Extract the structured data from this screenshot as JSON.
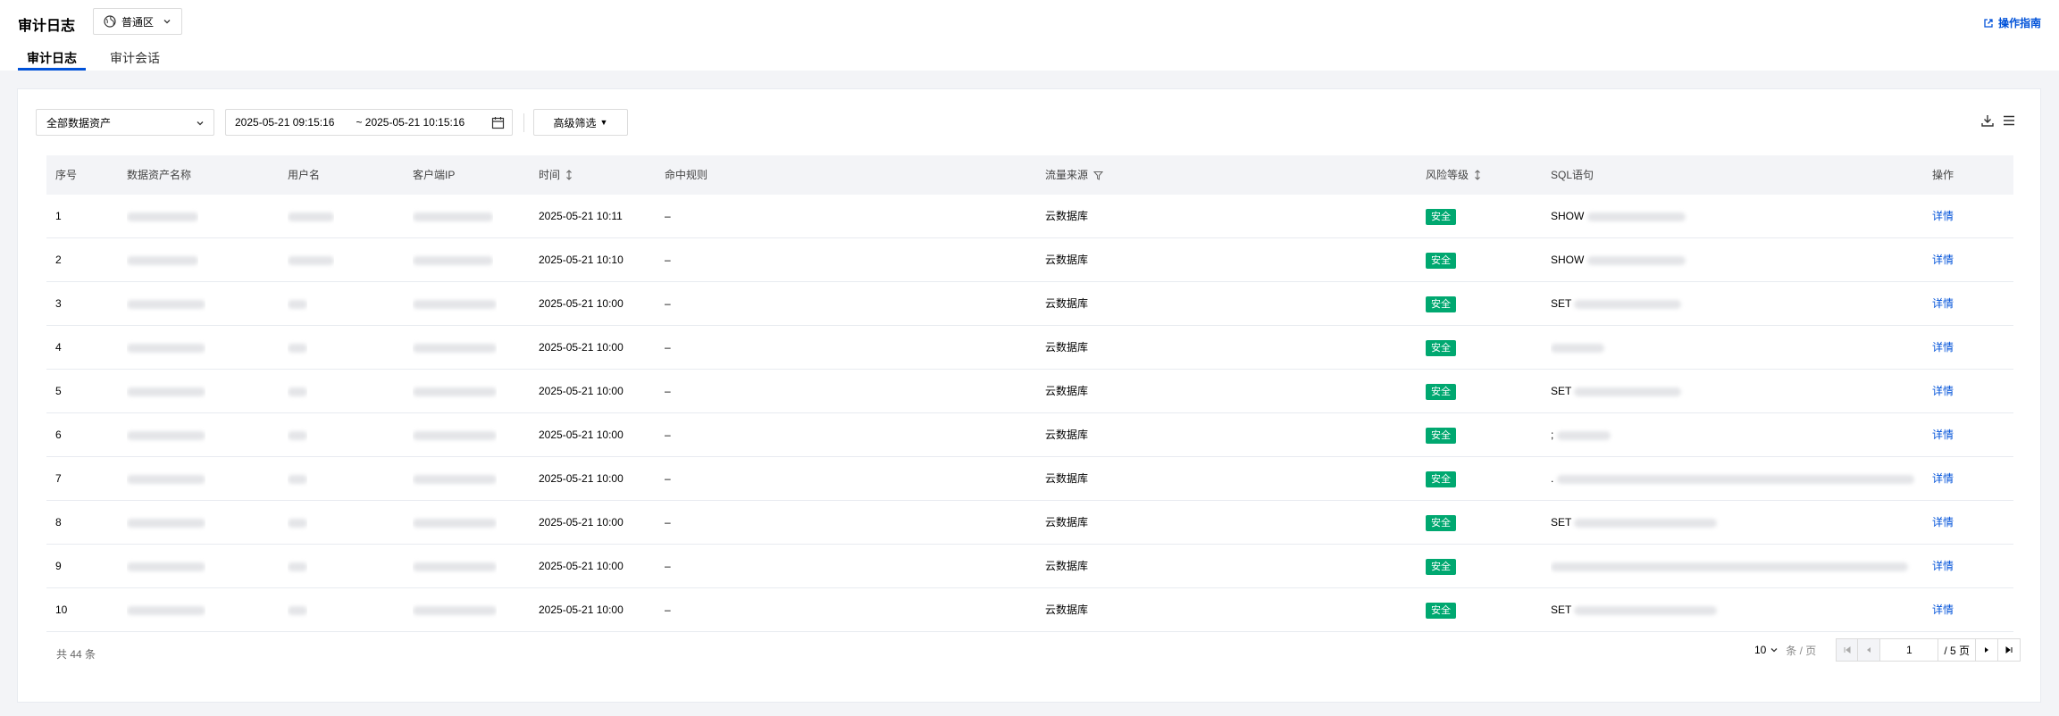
{
  "header": {
    "title": "审计日志",
    "region": "普通区",
    "guide": "操作指南"
  },
  "tabs": [
    {
      "label": "审计日志",
      "active": true
    },
    {
      "label": "审计会话",
      "active": false
    }
  ],
  "toolbar": {
    "asset_select": "全部数据资产",
    "date_start": "2025-05-21 09:15:16",
    "date_end": "~ 2025-05-21 10:15:16",
    "advanced_filter": "高级筛选"
  },
  "table": {
    "columns": [
      "序号",
      "数据资产名称",
      "用户名",
      "客户端IP",
      "时间",
      "命中规则",
      "流量来源",
      "风险等级",
      "SQL语句",
      "操作"
    ],
    "rows": [
      {
        "no": "1",
        "time": "2025-05-21 10:11",
        "rule": "–",
        "source": "云数据库",
        "risk": "安全",
        "sql": "SHOW",
        "action": "详情"
      },
      {
        "no": "2",
        "time": "2025-05-21 10:10",
        "rule": "–",
        "source": "云数据库",
        "risk": "安全",
        "sql": "SHOW",
        "action": "详情"
      },
      {
        "no": "3",
        "time": "2025-05-21 10:00",
        "rule": "–",
        "source": "云数据库",
        "risk": "安全",
        "sql": "SET",
        "action": "详情"
      },
      {
        "no": "4",
        "time": "2025-05-21 10:00",
        "rule": "–",
        "source": "云数据库",
        "risk": "安全",
        "sql": "",
        "action": "详情"
      },
      {
        "no": "5",
        "time": "2025-05-21 10:00",
        "rule": "–",
        "source": "云数据库",
        "risk": "安全",
        "sql": "SET",
        "action": "详情"
      },
      {
        "no": "6",
        "time": "2025-05-21 10:00",
        "rule": "–",
        "source": "云数据库",
        "risk": "安全",
        "sql": ";",
        "action": "详情"
      },
      {
        "no": "7",
        "time": "2025-05-21 10:00",
        "rule": "–",
        "source": "云数据库",
        "risk": "安全",
        "sql": ".",
        "action": "详情"
      },
      {
        "no": "8",
        "time": "2025-05-21 10:00",
        "rule": "–",
        "source": "云数据库",
        "risk": "安全",
        "sql": "SET",
        "action": "详情"
      },
      {
        "no": "9",
        "time": "2025-05-21 10:00",
        "rule": "–",
        "source": "云数据库",
        "risk": "安全",
        "sql": "",
        "action": "详情"
      },
      {
        "no": "10",
        "time": "2025-05-21 10:00",
        "rule": "–",
        "source": "云数据库",
        "risk": "安全",
        "sql": "SET",
        "action": "详情"
      }
    ]
  },
  "footer": {
    "total": "共 44 条",
    "page_size": "10",
    "page_unit": "条 / 页",
    "current_page": "1",
    "page_count": "/ 5 页"
  },
  "colors": {
    "accent": "#0052d9",
    "risk_safe": "#00a870"
  }
}
